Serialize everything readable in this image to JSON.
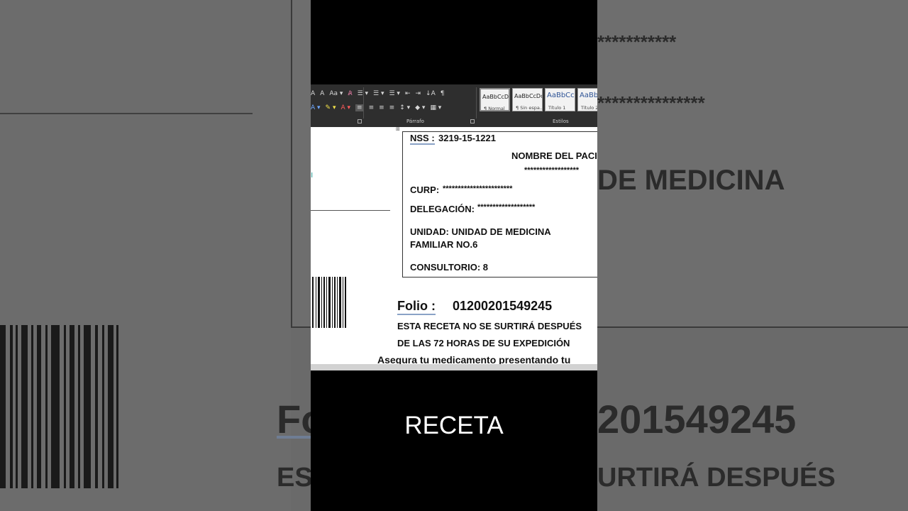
{
  "background": {
    "asterisks_1": "***********",
    "asterisks_2": "***************",
    "medicina": "DE MEDICINA",
    "folio_fragment": "Fo",
    "folio_number_fragment": "201549245",
    "es_fragment": "ES",
    "surtira_fragment": "URTIRÁ DESPUÉS"
  },
  "ribbon": {
    "row1": [
      "A",
      "A",
      "Aa ▾",
      "A̷",
      "☰ ▾",
      "☰ ▾",
      "☰ ▾",
      "⇤",
      "⇥",
      "↓A",
      "¶"
    ],
    "row2": [
      "A ▾",
      "✎ ▾",
      "A ▾",
      "≡",
      "≡",
      "≡",
      "≡",
      "↕ ▾",
      "◆ ▾",
      "▦ ▾"
    ],
    "parrafo_label": "Párrafo",
    "estilos_label": "Estilos",
    "styles": [
      {
        "preview": "AaBbCcDc",
        "name": "¶ Normal"
      },
      {
        "preview": "AaBbCcDc",
        "name": "¶ Sin espa..."
      },
      {
        "preview": "AaBbCc",
        "name": "Título 1"
      },
      {
        "preview": "AaBbC",
        "name": "Título 2"
      }
    ]
  },
  "document": {
    "nss_label": "NSS :",
    "nss_value": "3219-15-1221",
    "nombre_label": "NOMBRE DEL PACI",
    "nombre_value": "******************",
    "curp_label": "CURP:",
    "curp_value": "***********************",
    "delegacion_label": "DELEGACIÓN:",
    "delegacion_value": "*******************",
    "unidad_line1": "UNIDAD: UNIDAD DE MEDICINA",
    "unidad_line2": "FAMILIAR NO.6",
    "consultorio": "CONSULTORIO: 8",
    "folio_label": "Folio :",
    "folio_value": "01200201549245",
    "warning_line1": "ESTA RECETA NO SE SURTIRÁ DESPUÉS",
    "warning_line2": "DE LAS 72 HORAS DE SU EXPEDICIÓN",
    "footer_line": "Asegura tu medicamento presentando tu"
  },
  "caption": "RECETA"
}
